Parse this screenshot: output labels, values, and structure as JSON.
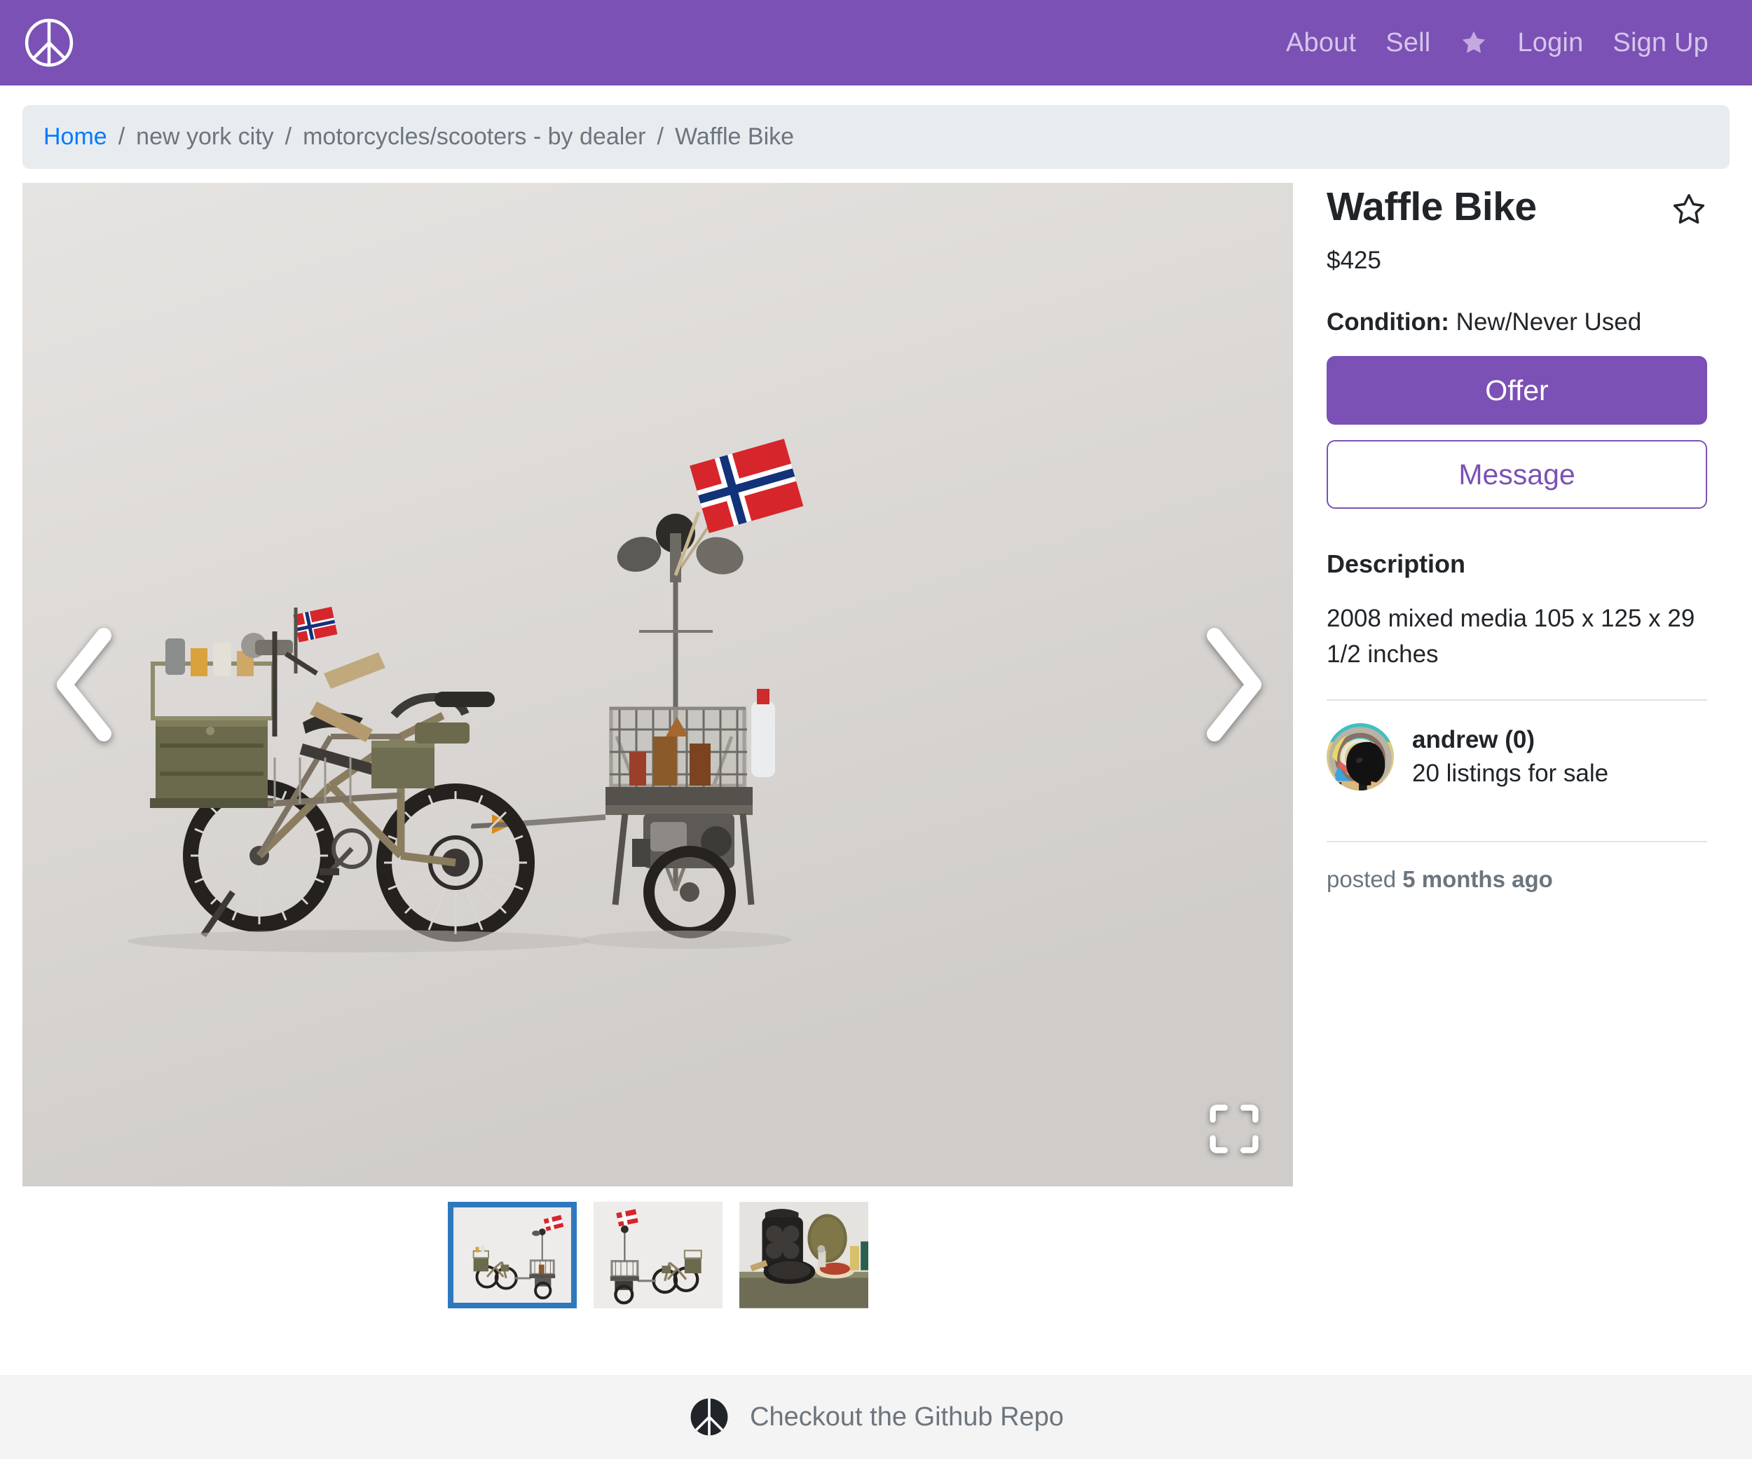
{
  "navbar": {
    "brand_icon": "peace-sign-logo",
    "links": [
      {
        "label": "About"
      },
      {
        "label": "Sell"
      },
      {
        "label": "Login"
      },
      {
        "label": "Sign Up"
      }
    ],
    "star_icon": "star-filled-icon",
    "background_color": "#7b51b5"
  },
  "breadcrumb": {
    "home_label": "Home",
    "separator": "/",
    "items": [
      {
        "label": "new york city"
      },
      {
        "label": "motorcycles/scooters - by dealer"
      },
      {
        "label": "Waffle Bike"
      }
    ],
    "link_color": "#007bff",
    "background_color": "#e9ecef"
  },
  "gallery": {
    "prev_icon": "chevron-left-icon",
    "next_icon": "chevron-right-icon",
    "fullscreen_icon": "fullscreen-expand-icon",
    "stage_background": "#d4d1cf",
    "selected_index": 0,
    "thumbnails": [
      {
        "name": "waffle-bike-side-view",
        "selected": true
      },
      {
        "name": "waffle-bike-reverse-view",
        "selected": false
      },
      {
        "name": "waffle-iron-detail",
        "selected": false
      }
    ]
  },
  "listing": {
    "title": "Waffle Bike",
    "favorite_icon": "star-outline-icon",
    "price": "$425",
    "condition_label": "Condition:",
    "condition_value": "New/Never Used",
    "offer_button": "Offer",
    "message_button": "Message",
    "description_heading": "Description",
    "description_text": "2008 mixed media 105 x 125 x 29 1/2 inches",
    "accent_color": "#7b51b5"
  },
  "seller": {
    "avatar_icon": "user-avatar",
    "name": "andrew (0)",
    "listings": "20 listings for sale"
  },
  "posted": {
    "prefix": "posted",
    "value": "5 months ago"
  },
  "footer": {
    "logo_icon": "peace-sign-logo",
    "link_label": "Checkout the Github Repo",
    "background_color": "#f4f4f5"
  }
}
